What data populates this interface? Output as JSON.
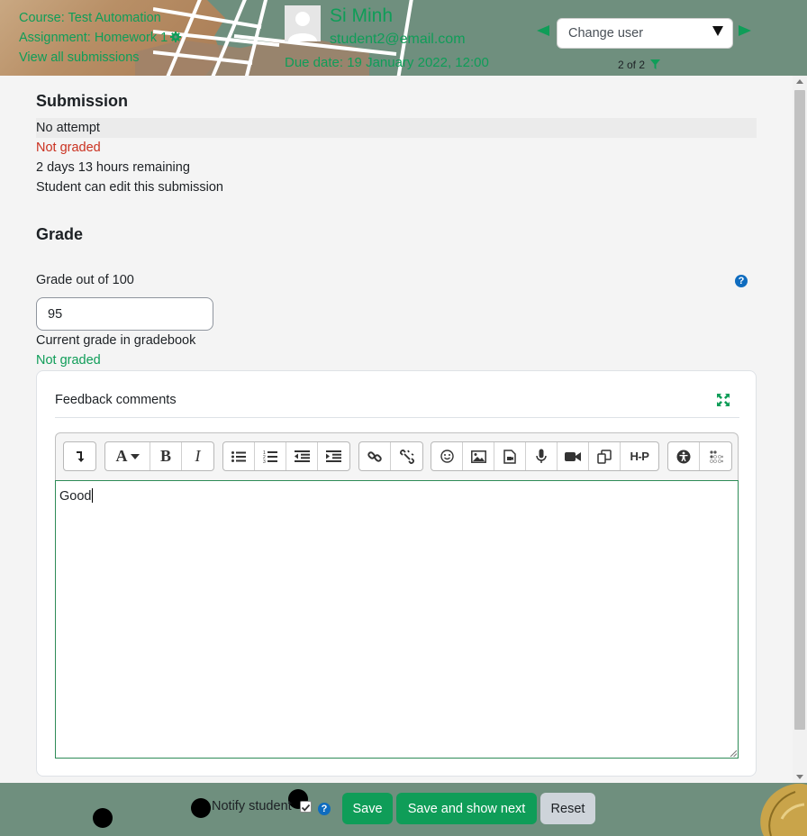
{
  "header": {
    "course_link": "Course: Test Automation",
    "assignment_link": "Assignment: Homework 1",
    "view_all_link": "View all submissions",
    "student_name": "Si Minh",
    "student_email": "student2@email.com",
    "due_date": "Due date: 19 January 2022, 12:00",
    "change_user": "Change user",
    "counter": "2 of 2"
  },
  "submission": {
    "heading": "Submission",
    "status": "No attempt",
    "grading_status": "Not graded",
    "time_remaining": "2 days 13 hours remaining",
    "edit_status": "Student can edit this submission"
  },
  "grade": {
    "heading": "Grade",
    "label": "Grade out of 100",
    "value": "95",
    "gradebook_label": "Current grade in gradebook",
    "gradebook_value": "Not graded"
  },
  "feedback": {
    "title": "Feedback comments",
    "text": "Good",
    "toolbar": {
      "bold": "B",
      "italic": "I",
      "font": "A",
      "h5p": "H-P"
    }
  },
  "footer": {
    "notify_label": "Notify student",
    "notify_checked": true,
    "save": "Save",
    "save_next": "Save and show next",
    "reset": "Reset"
  },
  "colors": {
    "accent": "#0f9d58",
    "error": "#ca3120",
    "header_bg": "#6f8f7e"
  }
}
